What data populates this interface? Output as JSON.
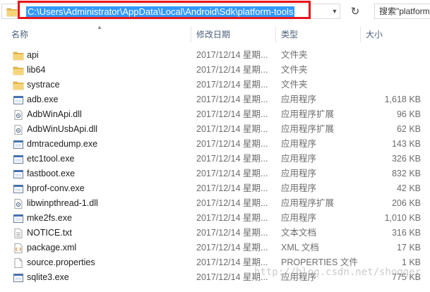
{
  "address_bar": {
    "path": "C:\\Users\\Administrator\\AppData\\Local\\Android\\Sdk\\platform-tools",
    "search_placeholder": "搜索\"platform"
  },
  "columns": {
    "name": "名称",
    "date": "修改日期",
    "type": "类型",
    "size": "大小"
  },
  "files": [
    {
      "name": "api",
      "date": "2017/12/14 星期...",
      "type": "文件夹",
      "size": "",
      "icon": "folder"
    },
    {
      "name": "lib64",
      "date": "2017/12/14 星期...",
      "type": "文件夹",
      "size": "",
      "icon": "folder"
    },
    {
      "name": "systrace",
      "date": "2017/12/14 星期...",
      "type": "文件夹",
      "size": "",
      "icon": "folder"
    },
    {
      "name": "adb.exe",
      "date": "2017/12/14 星期...",
      "type": "应用程序",
      "size": "1,618 KB",
      "icon": "exe"
    },
    {
      "name": "AdbWinApi.dll",
      "date": "2017/12/14 星期...",
      "type": "应用程序扩展",
      "size": "96 KB",
      "icon": "dll"
    },
    {
      "name": "AdbWinUsbApi.dll",
      "date": "2017/12/14 星期...",
      "type": "应用程序扩展",
      "size": "62 KB",
      "icon": "dll"
    },
    {
      "name": "dmtracedump.exe",
      "date": "2017/12/14 星期...",
      "type": "应用程序",
      "size": "143 KB",
      "icon": "exe"
    },
    {
      "name": "etc1tool.exe",
      "date": "2017/12/14 星期...",
      "type": "应用程序",
      "size": "326 KB",
      "icon": "exe"
    },
    {
      "name": "fastboot.exe",
      "date": "2017/12/14 星期...",
      "type": "应用程序",
      "size": "832 KB",
      "icon": "exe"
    },
    {
      "name": "hprof-conv.exe",
      "date": "2017/12/14 星期...",
      "type": "应用程序",
      "size": "42 KB",
      "icon": "exe"
    },
    {
      "name": "libwinpthread-1.dll",
      "date": "2017/12/14 星期...",
      "type": "应用程序扩展",
      "size": "206 KB",
      "icon": "dll"
    },
    {
      "name": "mke2fs.exe",
      "date": "2017/12/14 星期...",
      "type": "应用程序",
      "size": "1,010 KB",
      "icon": "exe"
    },
    {
      "name": "NOTICE.txt",
      "date": "2017/12/14 星期...",
      "type": "文本文档",
      "size": "316 KB",
      "icon": "txt"
    },
    {
      "name": "package.xml",
      "date": "2017/12/14 星期...",
      "type": "XML 文档",
      "size": "17 KB",
      "icon": "xml"
    },
    {
      "name": "source.properties",
      "date": "2017/12/14 星期...",
      "type": "PROPERTIES 文件",
      "size": "1 KB",
      "icon": "file"
    },
    {
      "name": "sqlite3.exe",
      "date": "2017/12/14 星期...",
      "type": "应用程序",
      "size": "775 KB",
      "icon": "exe"
    }
  ],
  "watermark": "http://blog.csdn.net/shogger",
  "colors": {
    "selection": "#3399ff",
    "highlight_border": "#e8141b",
    "folder": "#e8b84a",
    "header_text": "#4c607a"
  }
}
